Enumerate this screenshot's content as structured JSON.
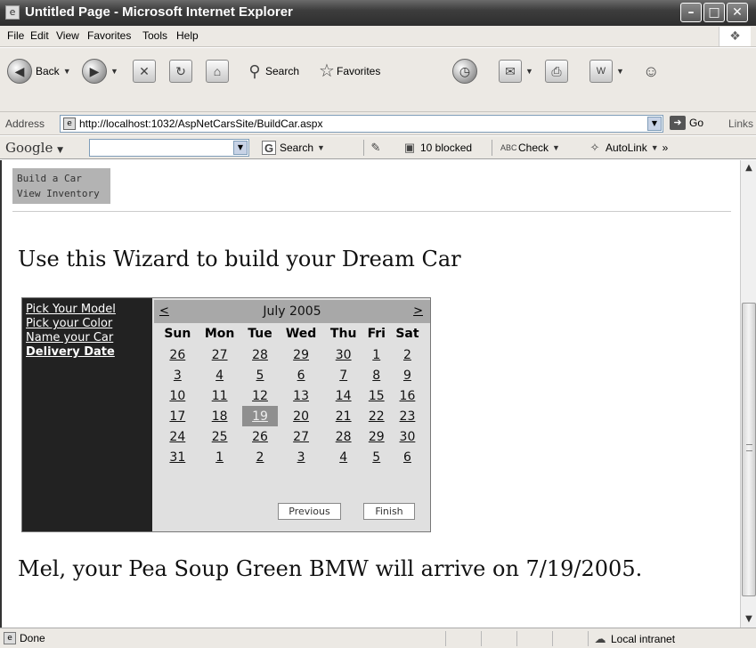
{
  "window": {
    "title": "Untitled Page - Microsoft Internet Explorer",
    "minimize_glyph": "–",
    "maximize_glyph": "□",
    "close_glyph": "✕"
  },
  "menu": [
    "File",
    "Edit",
    "View",
    "Favorites",
    "Tools",
    "Help"
  ],
  "toolbar": {
    "back_label": "Back",
    "search_label": "Search",
    "favorites_label": "Favorites"
  },
  "address": {
    "label": "Address",
    "url": "http://localhost:1032/AspNetCarsSite/BuildCar.aspx",
    "go_label": "Go",
    "links_label": "Links"
  },
  "google_toolbar": {
    "logo": "Google",
    "search_label": "Search",
    "blocked_label": "10 blocked",
    "check_label": "Check",
    "autolink_label": "AutoLink",
    "more_glyph": "»"
  },
  "page": {
    "nav_menu": [
      "Build a Car",
      "View Inventory"
    ],
    "headline": "Use this Wizard to build your Dream Car",
    "wizard": {
      "steps": [
        "Pick Your Model",
        "Pick your Color",
        "Name your Car",
        "Delivery Date"
      ],
      "active_step": "Delivery Date",
      "calendar": {
        "prev": "<",
        "next": ">",
        "month": "July 2005",
        "day_headers": [
          "Sun",
          "Mon",
          "Tue",
          "Wed",
          "Thu",
          "Fri",
          "Sat"
        ],
        "weeks": [
          [
            "26",
            "27",
            "28",
            "29",
            "30",
            "1",
            "2"
          ],
          [
            "3",
            "4",
            "5",
            "6",
            "7",
            "8",
            "9"
          ],
          [
            "10",
            "11",
            "12",
            "13",
            "14",
            "15",
            "16"
          ],
          [
            "17",
            "18",
            "19",
            "20",
            "21",
            "22",
            "23"
          ],
          [
            "24",
            "25",
            "26",
            "27",
            "28",
            "29",
            "30"
          ],
          [
            "31",
            "1",
            "2",
            "3",
            "4",
            "5",
            "6"
          ]
        ],
        "selected": "19"
      },
      "previous_button": "Previous",
      "finish_button": "Finish"
    },
    "message": "Mel, your Pea Soup Green BMW will arrive on 7/19/2005."
  },
  "status": {
    "text": "Done",
    "zone": "Local intranet"
  }
}
